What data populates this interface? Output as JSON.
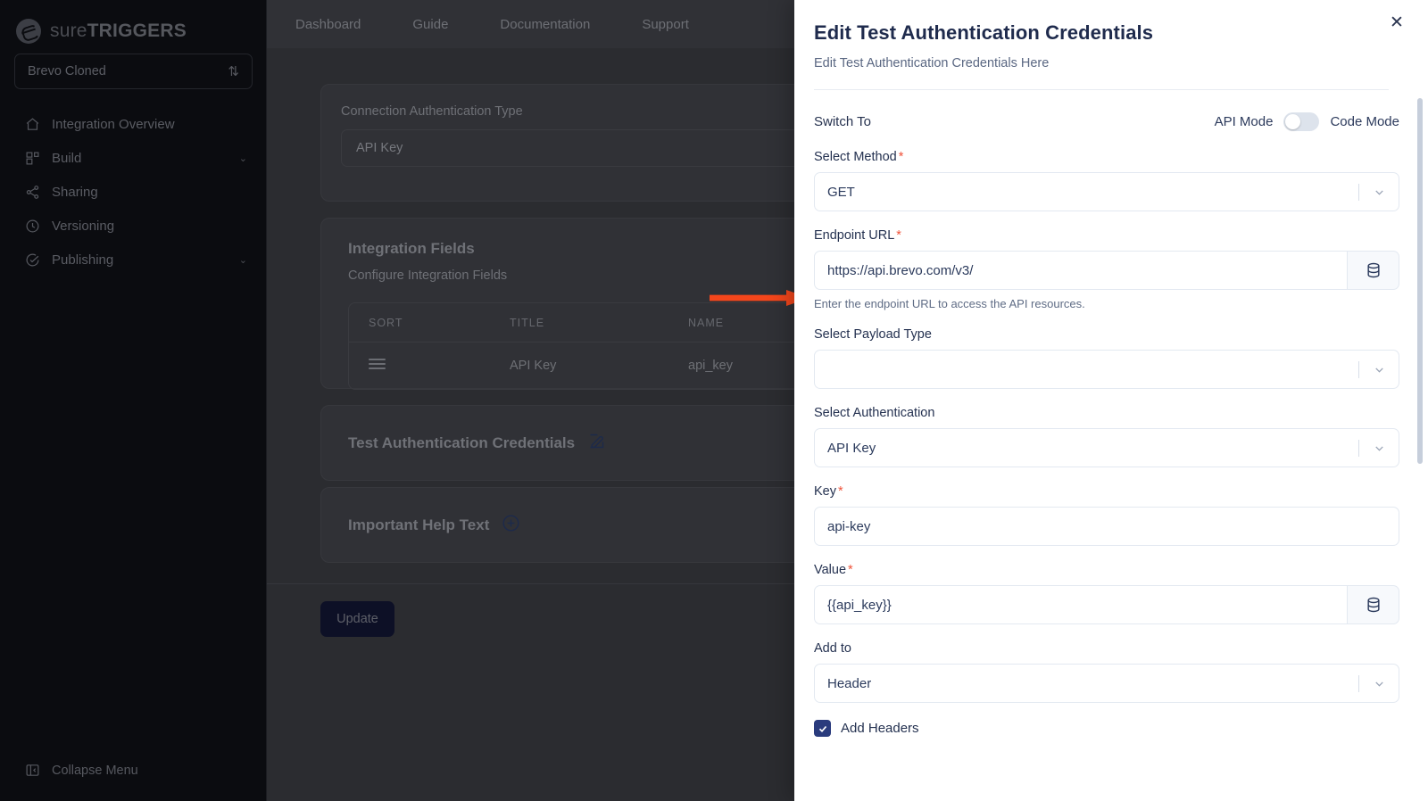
{
  "app": {
    "brand_thin": "sure",
    "brand_bold": "TRIGGERS",
    "project_selector": "Brevo Cloned",
    "collapse_menu": "Collapse Menu"
  },
  "sidebar": {
    "items": [
      {
        "label": "Integration Overview",
        "icon": "home-icon",
        "chevron": ""
      },
      {
        "label": "Build",
        "icon": "blocks-icon",
        "chevron": "⌄"
      },
      {
        "label": "Sharing",
        "icon": "share-icon",
        "chevron": ""
      },
      {
        "label": "Versioning",
        "icon": "clock-icon",
        "chevron": ""
      },
      {
        "label": "Publishing",
        "icon": "check-circle-icon",
        "chevron": "⌄"
      }
    ]
  },
  "topnav": {
    "items": [
      "Dashboard",
      "Guide",
      "Documentation",
      "Support"
    ]
  },
  "main": {
    "connection_auth_label": "Connection Authentication Type",
    "connection_auth_value": "API Key",
    "integration_fields_title": "Integration Fields",
    "integration_fields_sub": "Configure Integration Fields",
    "table": {
      "columns": [
        "SORT",
        "TITLE",
        "NAME"
      ],
      "rows": [
        {
          "sort": "drag-handle-icon",
          "title": "API Key",
          "name": "api_key"
        }
      ]
    },
    "test_auth_section": "Test Authentication Credentials",
    "help_text_section": "Important Help Text",
    "update_button": "Update"
  },
  "panel": {
    "title": "Edit Test Authentication Credentials",
    "subtitle": "Edit Test Authentication Credentials Here",
    "close_icon": "✕",
    "switch_to_label": "Switch To",
    "api_mode_label": "API Mode",
    "code_mode_label": "Code Mode",
    "toggle_state": "off",
    "fields": {
      "method": {
        "label": "Select Method",
        "required": "*",
        "value": "GET"
      },
      "endpoint": {
        "label": "Endpoint URL",
        "required": "*",
        "value": "https://api.brevo.com/v3/",
        "hint": "Enter the endpoint URL to access the API resources.",
        "button_icon": "database-icon"
      },
      "payload_type": {
        "label": "Select Payload Type",
        "required": "",
        "value": ""
      },
      "authentication": {
        "label": "Select Authentication",
        "required": "",
        "value": "API Key"
      },
      "key": {
        "label": "Key",
        "required": "*",
        "value": "api-key"
      },
      "value": {
        "label": "Value",
        "required": "*",
        "value": "{{api_key}}",
        "button_icon": "database-icon"
      },
      "add_to": {
        "label": "Add to",
        "required": "",
        "value": "Header"
      },
      "add_headers": {
        "label": "Add Headers",
        "checked": "true"
      }
    }
  },
  "annotation": {
    "arrow_color": "#F4461B",
    "arrow_direction": "right"
  },
  "colors": {
    "panel_bg": "#ffffff",
    "accent_navy": "#2a3b7d",
    "required_red": "#f0533a",
    "annotation_orange": "#F4461B"
  }
}
